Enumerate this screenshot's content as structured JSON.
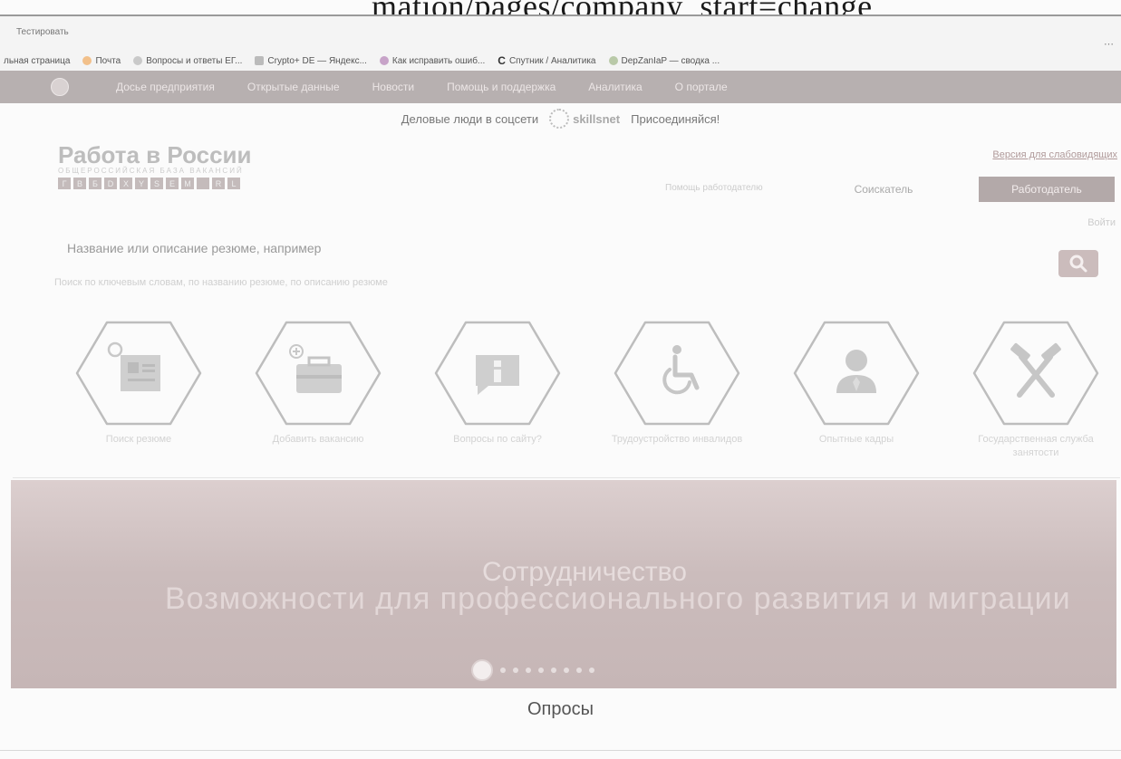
{
  "caption": "mation/pages/company_start=change",
  "browser": {
    "address_fragment": "Тестировать",
    "bookmarks": [
      {
        "label": "льная страница",
        "icon": "page-icon"
      },
      {
        "label": "Почта",
        "icon": "mail-icon"
      },
      {
        "label": "Вопросы и ответы ЕГ...",
        "icon": "question-icon"
      },
      {
        "label": "Crypto+ DE — Яндекс...",
        "icon": "chart-icon"
      },
      {
        "label": "Как исправить ошиб...",
        "icon": "globe-icon"
      },
      {
        "label": "Спутник / Аналитика",
        "icon": "sputnik-icon",
        "prefix": "С"
      },
      {
        "label": "DepZanIaP — сводка ...",
        "icon": "bars-icon"
      }
    ]
  },
  "nav": {
    "items": [
      "Досье предприятия",
      "Открытые данные",
      "Новости",
      "Помощь и поддержка",
      "Аналитика",
      "О портале"
    ]
  },
  "social": {
    "text": "Деловые люди в соцсети",
    "brand": "skillsnet",
    "cta": "Присоединяйся!"
  },
  "site": {
    "title": "Работа в России",
    "subtitle": "ОБЩЕРОССИЙСКАЯ БАЗА ВАКАНСИЙ",
    "alphabet": [
      "Г",
      "В",
      "Б",
      "D",
      "X",
      "Y",
      "S",
      "E",
      "M",
      "",
      "R",
      "L"
    ],
    "version_link": "Версия для слабовидящих",
    "role_hint": "Помощь работодателю",
    "roles": {
      "seeker": "Соискатель",
      "employer": "Работодатель"
    },
    "login": "Войти"
  },
  "search": {
    "placeholder": "Название или описание резюме, например",
    "hint": "Поиск по ключевым словам, по названию резюме, по описанию резюме"
  },
  "features": [
    {
      "label": "Поиск резюме",
      "icon": "resume-search-icon"
    },
    {
      "label": "Добавить вакансию",
      "icon": "add-vacancy-icon"
    },
    {
      "label": "Вопросы по сайту?",
      "icon": "info-icon"
    },
    {
      "label": "Трудоустройство инвалидов",
      "icon": "wheelchair-icon"
    },
    {
      "label": "Опытные кадры",
      "icon": "person-icon"
    },
    {
      "label": "Государственная служба занятости",
      "icon": "tools-icon"
    }
  ],
  "banner": {
    "line1": "Сотрудничество",
    "line2": "Возможности для профессионального развития и миграции",
    "slides": 9,
    "active_slide": 1
  },
  "sections": {
    "surveys": "Опросы"
  },
  "colors": {
    "nav_bg": "#b7b0b0",
    "accent": "#b3a9a9",
    "banner_bg": "#cbbcbc"
  }
}
